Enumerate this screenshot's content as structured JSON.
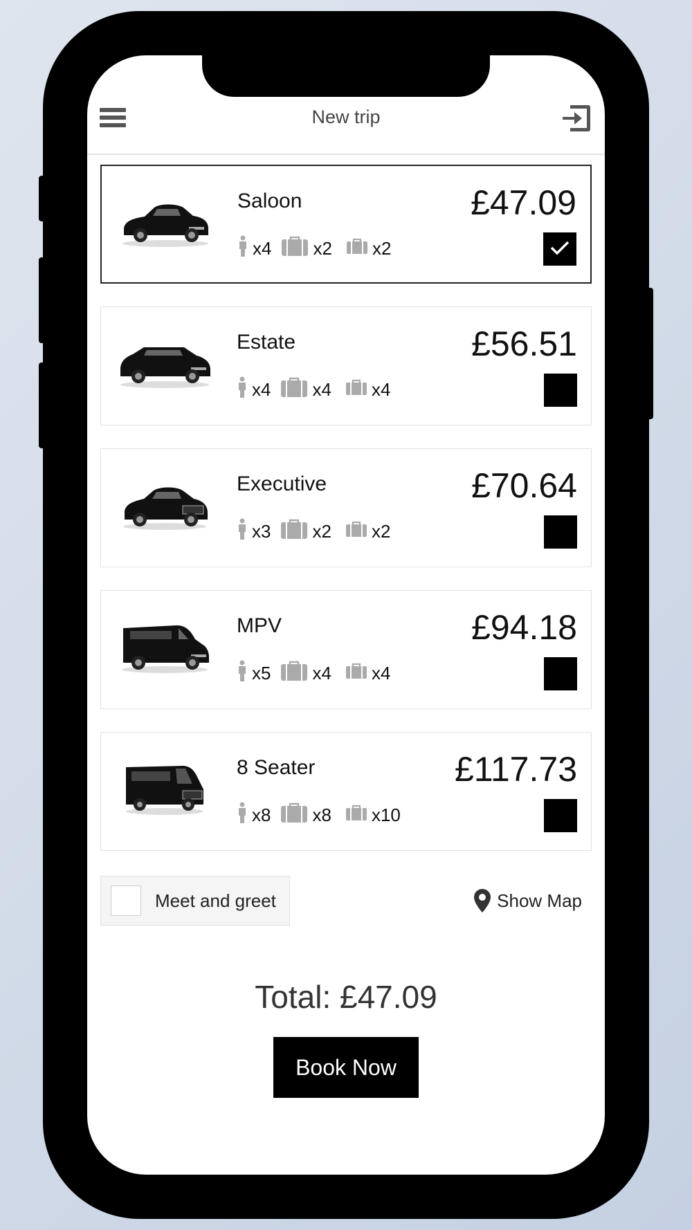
{
  "header": {
    "title": "New trip",
    "menu_icon": "hamburger-menu-icon",
    "logout_icon": "sign-out-icon"
  },
  "cars": [
    {
      "name": "Saloon",
      "price": "£47.09",
      "passengers": "x4",
      "large_bags": "x2",
      "small_bags": "x2",
      "selected": true,
      "shape": "sedan"
    },
    {
      "name": "Estate",
      "price": "£56.51",
      "passengers": "x4",
      "large_bags": "x4",
      "small_bags": "x4",
      "selected": false,
      "shape": "estate"
    },
    {
      "name": "Executive",
      "price": "£70.64",
      "passengers": "x3",
      "large_bags": "x2",
      "small_bags": "x2",
      "selected": false,
      "shape": "sedan-front"
    },
    {
      "name": "MPV",
      "price": "£94.18",
      "passengers": "x5",
      "large_bags": "x4",
      "small_bags": "x4",
      "selected": false,
      "shape": "van"
    },
    {
      "name": "8 Seater",
      "price": "£117.73",
      "passengers": "x8",
      "large_bags": "x8",
      "small_bags": "x10",
      "selected": false,
      "shape": "minibus"
    }
  ],
  "extras": {
    "meet_and_greet": "Meet and greet",
    "meet_and_greet_checked": false,
    "show_map": "Show Map",
    "map_icon": "map-pin-icon"
  },
  "total": "Total: £47.09",
  "book_button": "Book Now",
  "colors": {
    "accent": "#000000",
    "icon_gray": "#aaaaaa",
    "border": "#e2e2e2"
  }
}
